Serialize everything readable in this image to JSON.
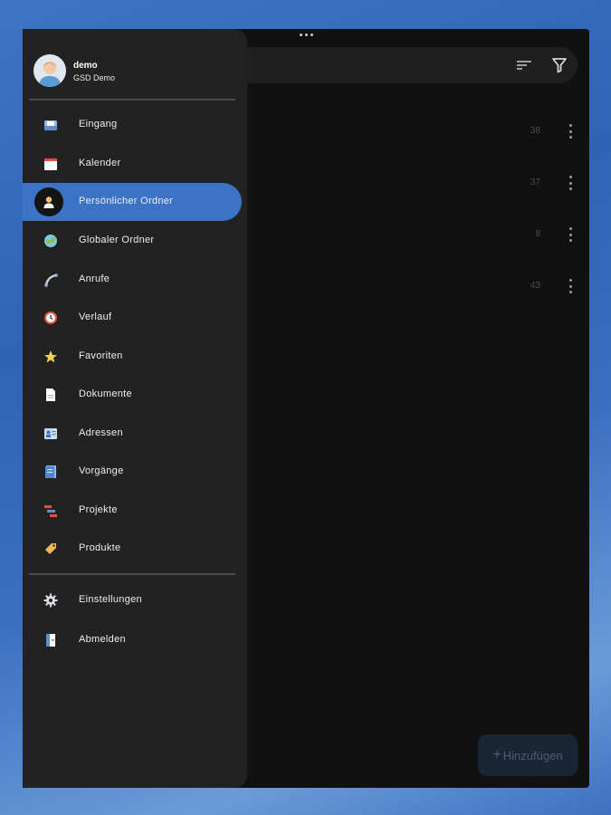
{
  "toolbar": {
    "sort_icon": "sort-icon",
    "filter_icon": "filter-icon"
  },
  "list": {
    "rows": [
      {
        "count": "38"
      },
      {
        "count": "37"
      },
      {
        "count": "8"
      },
      {
        "count": "43"
      }
    ]
  },
  "fab": {
    "icon": "+",
    "label": "Hinzufügen"
  },
  "drawer": {
    "user": {
      "name": "demo",
      "company": "GSD Demo"
    },
    "items": [
      {
        "label": "Eingang",
        "icon": "inbox-icon"
      },
      {
        "label": "Kalender",
        "icon": "calendar-icon"
      },
      {
        "label": "Persönlicher Ordner",
        "icon": "personal-folder-icon",
        "active": true
      },
      {
        "label": "Globaler Ordner",
        "icon": "globe-icon"
      },
      {
        "label": "Anrufe",
        "icon": "phone-icon"
      },
      {
        "label": "Verlauf",
        "icon": "clock-icon"
      },
      {
        "label": "Favoriten",
        "icon": "star-icon"
      },
      {
        "label": "Dokumente",
        "icon": "document-icon"
      },
      {
        "label": "Adressen",
        "icon": "address-card-icon"
      },
      {
        "label": "Vorgänge",
        "icon": "task-icon"
      },
      {
        "label": "Projekte",
        "icon": "project-icon"
      },
      {
        "label": "Produkte",
        "icon": "tag-icon"
      }
    ],
    "footer_items": [
      {
        "label": "Einstellungen",
        "icon": "gear-icon"
      },
      {
        "label": "Abmelden",
        "icon": "logout-icon"
      }
    ]
  },
  "colors": {
    "accent": "#3d73c4",
    "background": "#111111",
    "drawer": "#222222"
  }
}
